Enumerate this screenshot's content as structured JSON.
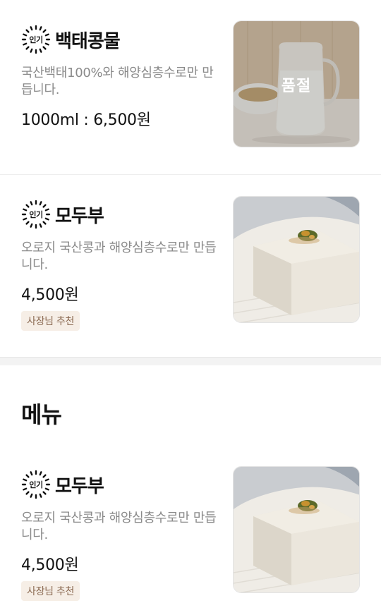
{
  "popular_badge": "인기",
  "items": [
    {
      "name": "백태콩물",
      "description": "국산백태100%와 해양심층수로만 만듭니다.",
      "price": "1000ml : 6,500원",
      "status": "품절"
    },
    {
      "name": "모두부",
      "description": "오로지 국산콩과 해양심층수로만 만듭니다.",
      "price": "4,500원",
      "tag": "사장님 추천"
    }
  ],
  "menu_section": {
    "title": "메뉴",
    "items": [
      {
        "name": "모두부",
        "description": "오로지 국산콩과 해양심층수로만 만듭니다.",
        "price": "4,500원",
        "tag": "사장님 추천"
      }
    ]
  },
  "colors": {
    "tag_bg": "#f6eee6",
    "tag_text": "#8b6a52",
    "desc_text": "#8a8a8a"
  }
}
